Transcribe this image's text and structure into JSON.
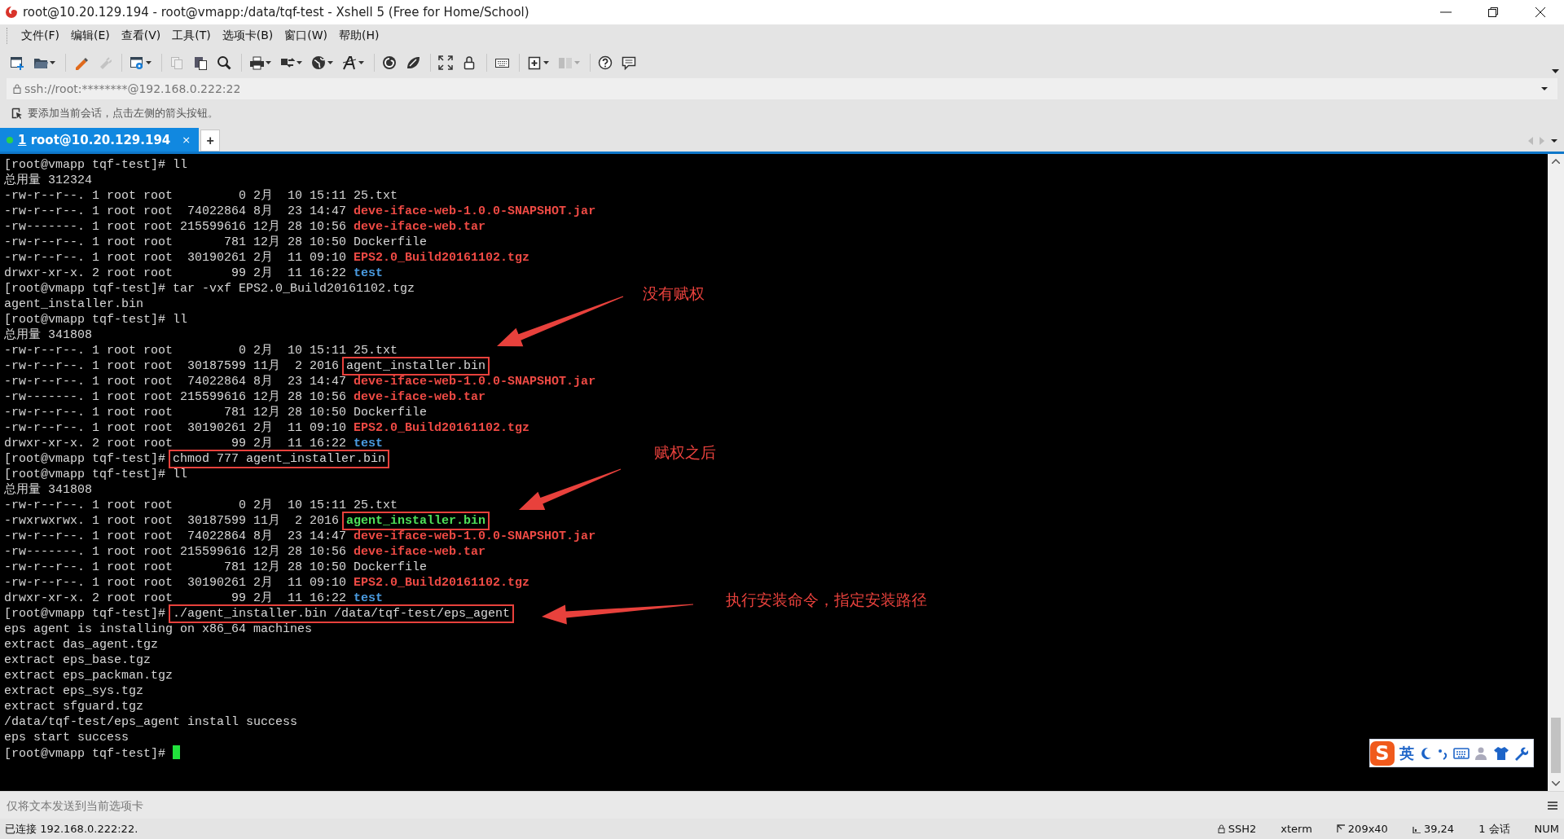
{
  "window": {
    "title": "root@10.20.129.194 - root@vmapp:/data/tqf-test - Xshell 5 (Free for Home/School)"
  },
  "menu": [
    "文件(F)",
    "编辑(E)",
    "查看(V)",
    "工具(T)",
    "选项卡(B)",
    "窗口(W)",
    "帮助(H)"
  ],
  "toolbar": [
    [
      {
        "kind": "new-window",
        "disabled": false,
        "dropdown": false
      },
      {
        "kind": "folder",
        "disabled": false,
        "dropdown": true
      }
    ],
    [
      {
        "kind": "pen",
        "disabled": false,
        "dropdown": false
      },
      {
        "kind": "plug",
        "disabled": true,
        "dropdown": false
      }
    ],
    [
      {
        "kind": "window-gear",
        "disabled": false,
        "dropdown": true
      }
    ],
    [
      {
        "kind": "copy",
        "disabled": true,
        "dropdown": false
      },
      {
        "kind": "paste",
        "disabled": false,
        "dropdown": false
      },
      {
        "kind": "search",
        "disabled": false,
        "dropdown": false
      }
    ],
    [
      {
        "kind": "printer",
        "disabled": false,
        "dropdown": true
      },
      {
        "kind": "transfer",
        "disabled": false,
        "dropdown": true
      },
      {
        "kind": "globe",
        "disabled": false,
        "dropdown": true
      },
      {
        "kind": "font",
        "disabled": false,
        "dropdown": true
      }
    ],
    [
      {
        "kind": "swirl",
        "disabled": false,
        "dropdown": false
      },
      {
        "kind": "leaf",
        "disabled": false,
        "dropdown": false
      }
    ],
    [
      {
        "kind": "fullscreen",
        "disabled": false,
        "dropdown": false
      },
      {
        "kind": "lock",
        "disabled": false,
        "dropdown": false
      }
    ],
    [
      {
        "kind": "keyboard",
        "disabled": false,
        "dropdown": false
      }
    ],
    [
      {
        "kind": "add",
        "disabled": false,
        "dropdown": true
      },
      {
        "kind": "layout",
        "disabled": true,
        "dropdown": true
      }
    ],
    [
      {
        "kind": "help",
        "disabled": false,
        "dropdown": false
      },
      {
        "kind": "chat",
        "disabled": false,
        "dropdown": false
      }
    ]
  ],
  "address_bar": {
    "value": "ssh://root:********@192.168.0.222:22"
  },
  "hint_bar": {
    "text": "要添加当前会话，点击左侧的箭头按钮。"
  },
  "tabs": [
    {
      "number": "1",
      "label": "root@10.20.129.194",
      "selected": true,
      "connected": true,
      "close": "×"
    }
  ],
  "new_tab": "+",
  "terminal": {
    "cursor_visible": true,
    "lines": [
      [
        {
          "text": "[root@vmapp tqf-test]# ll",
          "kind": "plain",
          "boxed": false
        }
      ],
      [
        {
          "text": "总用量 312324",
          "kind": "plain",
          "boxed": false
        }
      ],
      [
        {
          "text": "-rw-r--r--. 1 root root         0 2月  10 15:11 25.txt",
          "kind": "plain",
          "boxed": false
        }
      ],
      [
        {
          "text": "-rw-r--r--. 1 root root  74022864 8月  23 14:47 ",
          "kind": "plain",
          "boxed": false
        },
        {
          "text": "deve-iface-web-1.0.0-SNAPSHOT.jar",
          "kind": "archive",
          "boxed": false
        }
      ],
      [
        {
          "text": "-rw-------. 1 root root 215599616 12月 28 10:56 ",
          "kind": "plain",
          "boxed": false
        },
        {
          "text": "deve-iface-web.tar",
          "kind": "archive",
          "boxed": false
        }
      ],
      [
        {
          "text": "-rw-r--r--. 1 root root       781 12月 28 10:50 Dockerfile",
          "kind": "plain",
          "boxed": false
        }
      ],
      [
        {
          "text": "-rw-r--r--. 1 root root  30190261 2月  11 09:10 ",
          "kind": "plain",
          "boxed": false
        },
        {
          "text": "EPS2.0_Build20161102.tgz",
          "kind": "archive",
          "boxed": false
        }
      ],
      [
        {
          "text": "drwxr-xr-x. 2 root root        99 2月  11 16:22 ",
          "kind": "plain",
          "boxed": false
        },
        {
          "text": "test",
          "kind": "directory",
          "boxed": false
        }
      ],
      [
        {
          "text": "[root@vmapp tqf-test]# tar -vxf EPS2.0_Build20161102.tgz",
          "kind": "plain",
          "boxed": false
        }
      ],
      [
        {
          "text": "agent_installer.bin",
          "kind": "plain",
          "boxed": false
        }
      ],
      [
        {
          "text": "[root@vmapp tqf-test]# ll",
          "kind": "plain",
          "boxed": false
        }
      ],
      [
        {
          "text": "总用量 341808",
          "kind": "plain",
          "boxed": false
        }
      ],
      [
        {
          "text": "-rw-r--r--. 1 root root         0 2月  10 15:11 25.txt",
          "kind": "plain",
          "boxed": false
        }
      ],
      [
        {
          "text": "-rw-r--r--. 1 root root  30187599 11月  2 2016 ",
          "kind": "plain",
          "boxed": false
        },
        {
          "text": "agent_installer.bin",
          "kind": "plain",
          "boxed": true
        }
      ],
      [
        {
          "text": "-rw-r--r--. 1 root root  74022864 8月  23 14:47 ",
          "kind": "plain",
          "boxed": false
        },
        {
          "text": "deve-iface-web-1.0.0-SNAPSHOT.jar",
          "kind": "archive",
          "boxed": false
        }
      ],
      [
        {
          "text": "-rw-------. 1 root root 215599616 12月 28 10:56 ",
          "kind": "plain",
          "boxed": false
        },
        {
          "text": "deve-iface-web.tar",
          "kind": "archive",
          "boxed": false
        }
      ],
      [
        {
          "text": "-rw-r--r--. 1 root root       781 12月 28 10:50 Dockerfile",
          "kind": "plain",
          "boxed": false
        }
      ],
      [
        {
          "text": "-rw-r--r--. 1 root root  30190261 2月  11 09:10 ",
          "kind": "plain",
          "boxed": false
        },
        {
          "text": "EPS2.0_Build20161102.tgz",
          "kind": "archive",
          "boxed": false
        }
      ],
      [
        {
          "text": "drwxr-xr-x. 2 root root        99 2月  11 16:22 ",
          "kind": "plain",
          "boxed": false
        },
        {
          "text": "test",
          "kind": "directory",
          "boxed": false
        }
      ],
      [
        {
          "text": "[root@vmapp tqf-test]# ",
          "kind": "plain",
          "boxed": false
        },
        {
          "text": "chmod 777 agent_installer.bin",
          "kind": "plain",
          "boxed": true
        }
      ],
      [
        {
          "text": "[root@vmapp tqf-test]# ll",
          "kind": "plain",
          "boxed": false
        }
      ],
      [
        {
          "text": "总用量 341808",
          "kind": "plain",
          "boxed": false
        }
      ],
      [
        {
          "text": "-rw-r--r--. 1 root root         0 2月  10 15:11 25.txt",
          "kind": "plain",
          "boxed": false
        }
      ],
      [
        {
          "text": "-rwxrwxrwx. 1 root root  30187599 11月  2 2016 ",
          "kind": "plain",
          "boxed": false
        },
        {
          "text": "agent_installer.bin",
          "kind": "executable",
          "boxed": true
        }
      ],
      [
        {
          "text": "-rw-r--r--. 1 root root  74022864 8月  23 14:47 ",
          "kind": "plain",
          "boxed": false
        },
        {
          "text": "deve-iface-web-1.0.0-SNAPSHOT.jar",
          "kind": "archive",
          "boxed": false
        }
      ],
      [
        {
          "text": "-rw-------. 1 root root 215599616 12月 28 10:56 ",
          "kind": "plain",
          "boxed": false
        },
        {
          "text": "deve-iface-web.tar",
          "kind": "archive",
          "boxed": false
        }
      ],
      [
        {
          "text": "-rw-r--r--. 1 root root       781 12月 28 10:50 Dockerfile",
          "kind": "plain",
          "boxed": false
        }
      ],
      [
        {
          "text": "-rw-r--r--. 1 root root  30190261 2月  11 09:10 ",
          "kind": "plain",
          "boxed": false
        },
        {
          "text": "EPS2.0_Build20161102.tgz",
          "kind": "archive",
          "boxed": false
        }
      ],
      [
        {
          "text": "drwxr-xr-x. 2 root root        99 2月  11 16:22 ",
          "kind": "plain",
          "boxed": false
        },
        {
          "text": "test",
          "kind": "directory",
          "boxed": false
        }
      ],
      [
        {
          "text": "[root@vmapp tqf-test]# ",
          "kind": "plain",
          "boxed": false
        },
        {
          "text": "./agent_installer.bin /data/tqf-test/eps_agent",
          "kind": "plain",
          "boxed": true
        }
      ],
      [
        {
          "text": "eps agent is installing on x86_64 machines",
          "kind": "plain",
          "boxed": false
        }
      ],
      [
        {
          "text": "extract das_agent.tgz",
          "kind": "plain",
          "boxed": false
        }
      ],
      [
        {
          "text": "extract eps_base.tgz",
          "kind": "plain",
          "boxed": false
        }
      ],
      [
        {
          "text": "extract eps_packman.tgz",
          "kind": "plain",
          "boxed": false
        }
      ],
      [
        {
          "text": "extract eps_sys.tgz",
          "kind": "plain",
          "boxed": false
        }
      ],
      [
        {
          "text": "extract sfguard.tgz",
          "kind": "plain",
          "boxed": false
        }
      ],
      [
        {
          "text": "/data/tqf-test/eps_agent install success",
          "kind": "plain",
          "boxed": false
        }
      ],
      [
        {
          "text": "eps start success",
          "kind": "plain",
          "boxed": false
        }
      ],
      [
        {
          "text": "[root@vmapp tqf-test]# ",
          "kind": "plain",
          "boxed": false
        }
      ]
    ]
  },
  "annotations": [
    "没有赋权",
    "赋权之后",
    "执行安装命令，指定安装路径"
  ],
  "ime_toolbar": {
    "logo": "S",
    "mode": "英"
  },
  "input_bar": {
    "placeholder": "仅将文本发送到当前选项卡"
  },
  "status_bar": {
    "connection": "已连接 192.168.0.222:22.",
    "items": [
      {
        "kind": "protocol",
        "text": "SSH2"
      },
      {
        "kind": "terminal",
        "text": "xterm"
      },
      {
        "kind": "size",
        "text": "209x40"
      },
      {
        "kind": "position",
        "text": "39,24"
      },
      {
        "kind": "sessions",
        "text": "1 会话"
      },
      {
        "kind": "keys",
        "text": "NUM"
      }
    ]
  }
}
